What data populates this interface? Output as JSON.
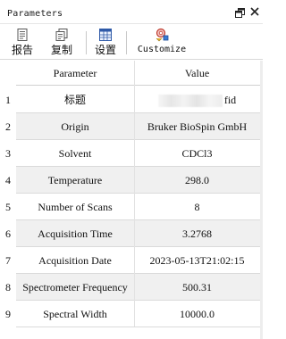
{
  "panel": {
    "title": "Parameters"
  },
  "toolbar": {
    "buttons": [
      {
        "label": "报告",
        "icon": "report-icon"
      },
      {
        "label": "复制",
        "icon": "copy-icon"
      },
      {
        "label": "设置",
        "icon": "settings-table-icon"
      },
      {
        "label": "Customize",
        "icon": "customize-icon"
      }
    ]
  },
  "table": {
    "headers": {
      "parameter": "Parameter",
      "value": "Value"
    },
    "rows": [
      {
        "num": "1",
        "parameter": "标题",
        "value": "fid",
        "redacted_prefix": true
      },
      {
        "num": "2",
        "parameter": "Origin",
        "value": "Bruker BioSpin GmbH"
      },
      {
        "num": "3",
        "parameter": "Solvent",
        "value": "CDCl3"
      },
      {
        "num": "4",
        "parameter": "Temperature",
        "value": "298.0"
      },
      {
        "num": "5",
        "parameter": "Number of Scans",
        "value": "8"
      },
      {
        "num": "6",
        "parameter": "Acquisition Time",
        "value": "3.2768"
      },
      {
        "num": "7",
        "parameter": "Acquisition Date",
        "value": "2023-05-13T21:02:15"
      },
      {
        "num": "8",
        "parameter": "Spectrometer Frequency",
        "value": "500.31"
      },
      {
        "num": "9",
        "parameter": "Spectral Width",
        "value": "10000.0"
      }
    ]
  }
}
